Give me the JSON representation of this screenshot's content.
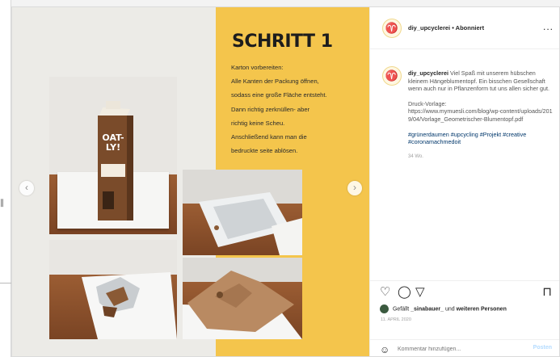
{
  "header": {
    "username": "diy_upcyclerei",
    "separator": "•",
    "follow_label": "Abonniert",
    "more": "..."
  },
  "slide": {
    "title": "SCHRITT 1",
    "lines": [
      "Karton vorbereiten:",
      "Alle Kanten der Packung öffnen,",
      "sodass eine große Fläche entsteht.",
      "Dann richtig zerknüllen- aber",
      "richtig keine Scheu.",
      "Anschließend kann man die",
      "bedruckte seite ablösen."
    ],
    "carton_text": "OAT-LY!"
  },
  "caption": {
    "username": "diy_upcyclerei",
    "text": "Viel Spaß mit unserem hübschen kleinem Hängeblumentopf. Ein bisschen Gesellschaft wenn auch nur in Pflanzenform tut uns allen sicher gut.",
    "druck": "Druck-Vorlage:",
    "url": "https://www.mymuesli.com/blog/wp-content/uploads/2019/04/Vorlage_Geometrischer-Blumentopf.pdf",
    "hashtags": "#grünerdaumen #upcycling #Projekt #creative #coronamachmedoit",
    "time": "34 Wo."
  },
  "likes": {
    "prefix": "Gefällt",
    "user": "_sinabauer_",
    "middle": "und",
    "rest": "weiteren Personen"
  },
  "date": "11. APRIL 2020",
  "comment": {
    "placeholder": "Kommentar hinzufügen...",
    "post_label": "Posten"
  },
  "icons": {
    "like": "heart-icon",
    "comment": "comment-icon",
    "share": "share-icon",
    "save": "bookmark-icon",
    "emoji": "emoji-icon",
    "prev": "chevron-left-icon",
    "next": "chevron-right-icon"
  },
  "colors": {
    "slide_yellow": "#f4c54c",
    "hashtag": "#00376b",
    "post_button": "#b3dbff"
  }
}
